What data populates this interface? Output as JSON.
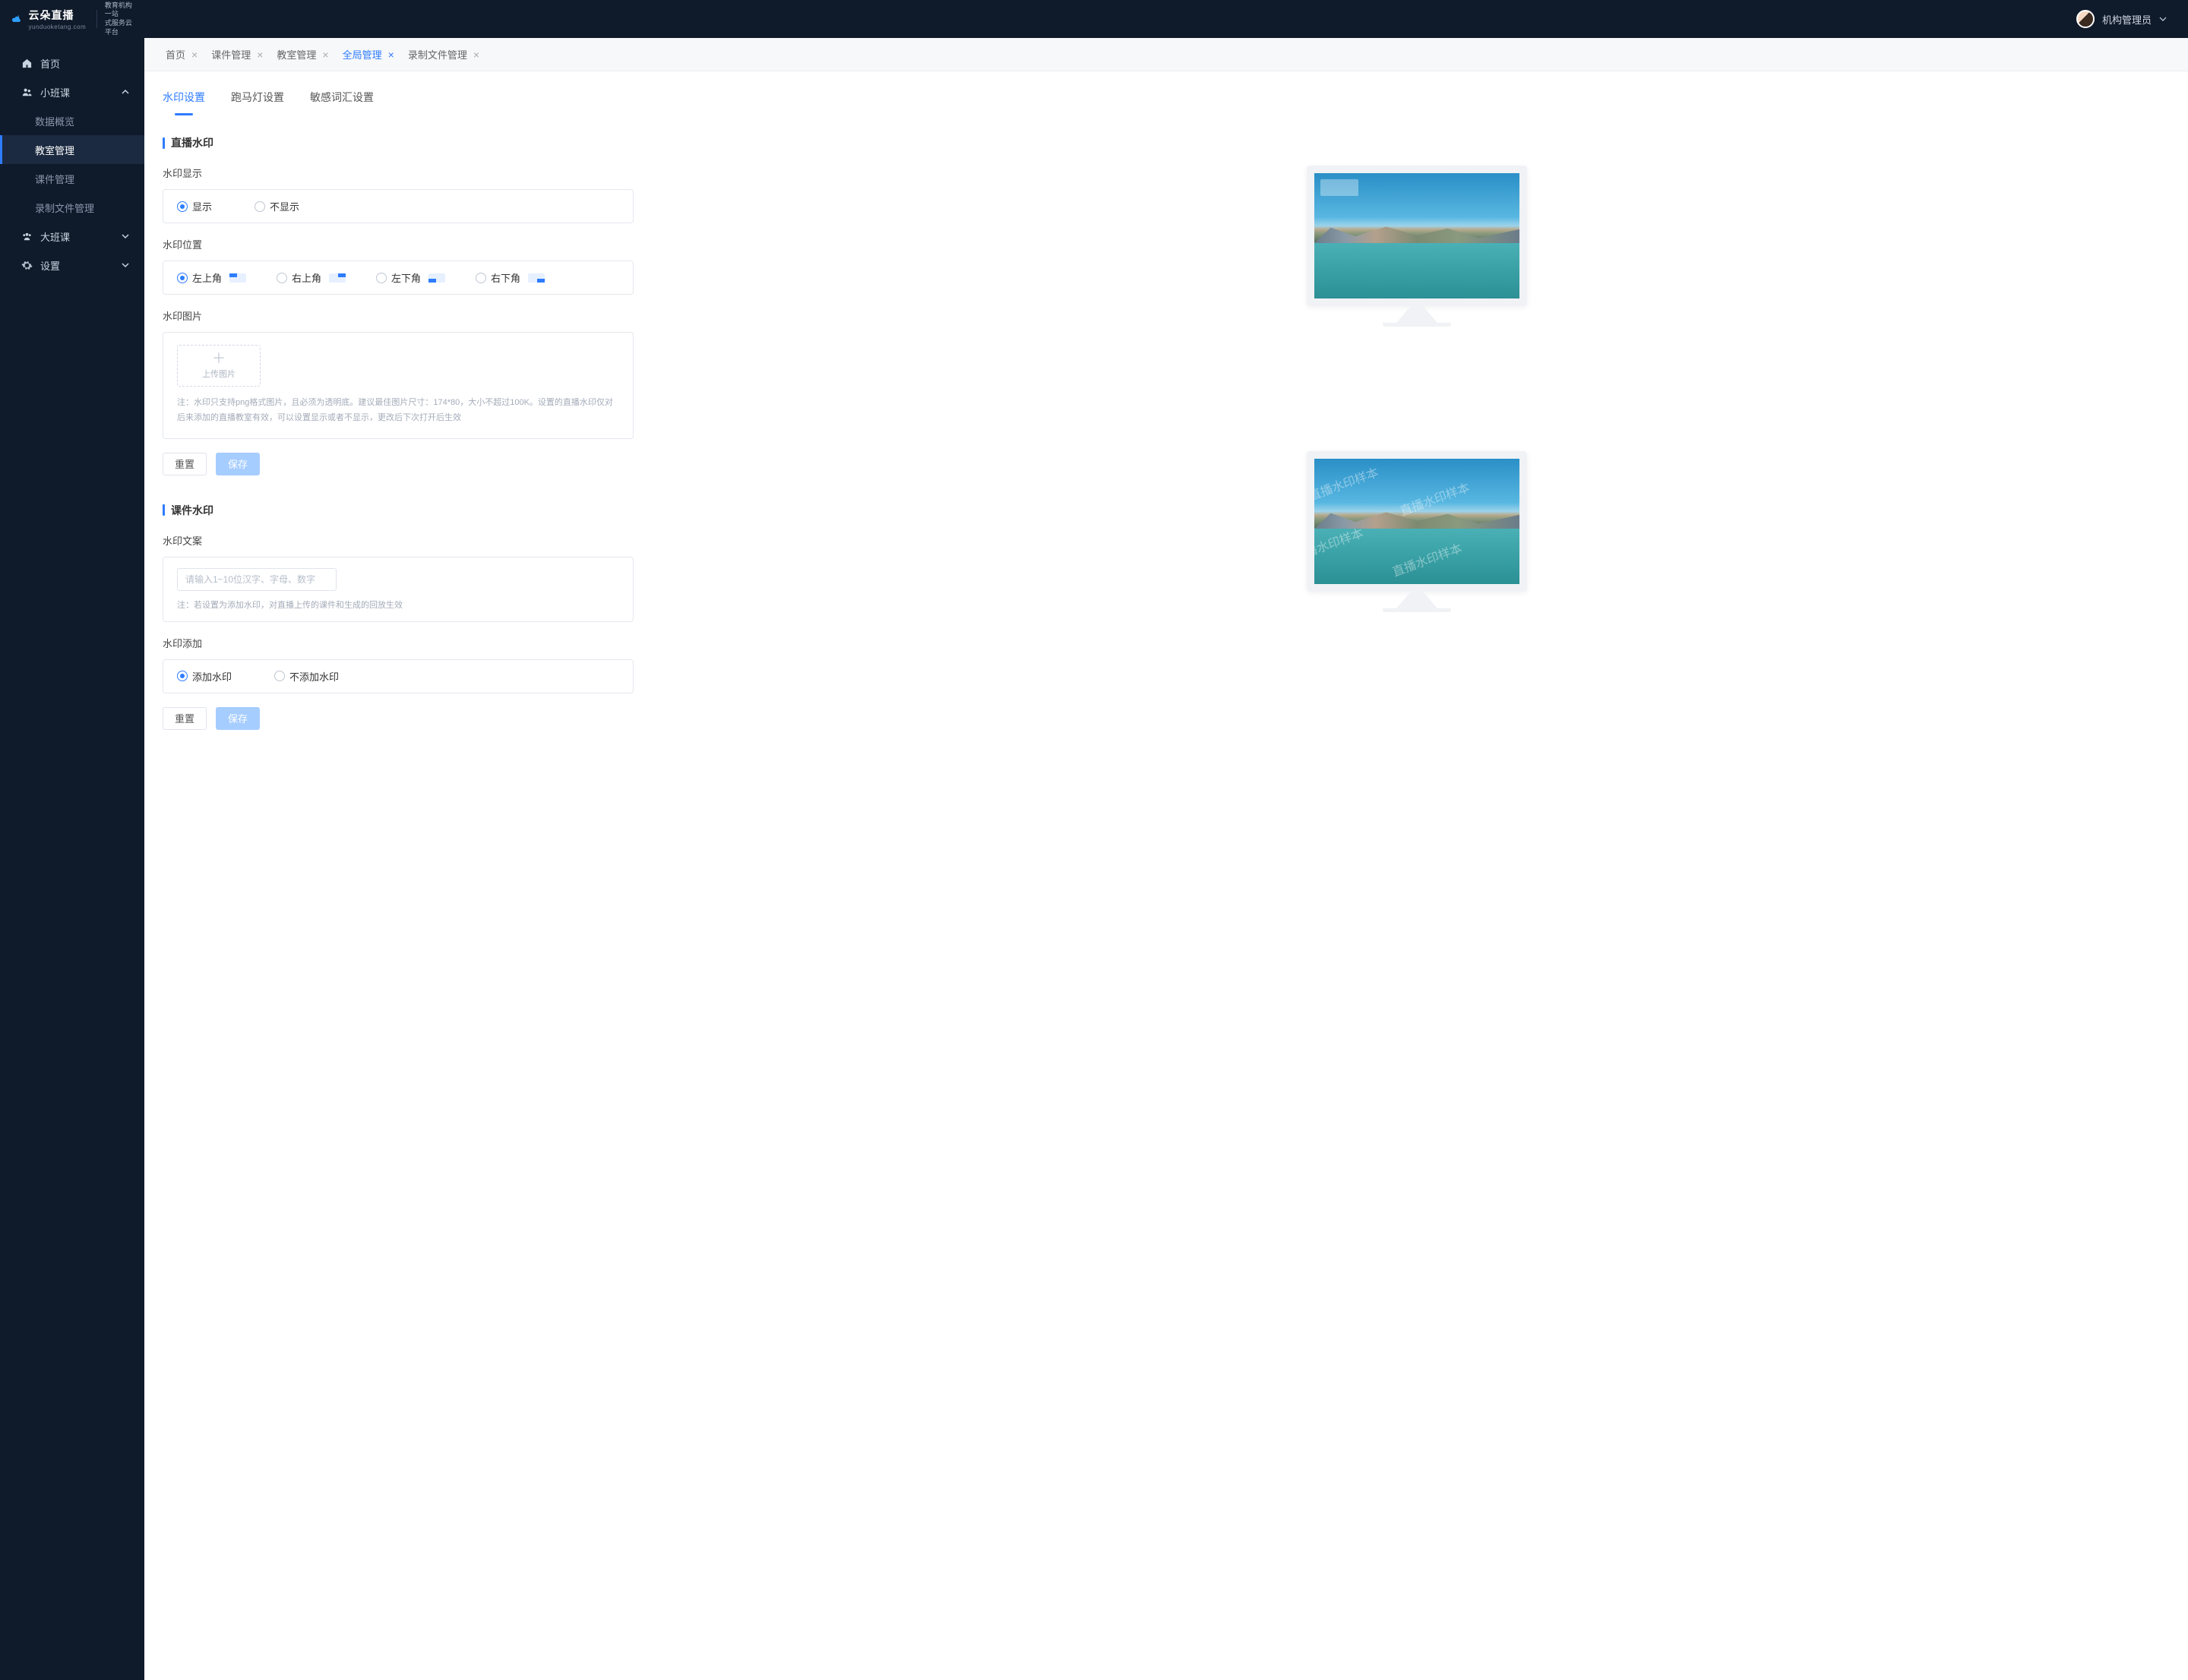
{
  "brand": {
    "title": "云朵直播",
    "subtitle": "yunduoketang.com",
    "tagline1": "教育机构一站",
    "tagline2": "式服务云平台"
  },
  "user": {
    "name": "机构管理员"
  },
  "sidebar": {
    "home": "首页",
    "small_class": "小班课",
    "sub": {
      "data_overview": "数据概览",
      "classroom_mgmt": "教室管理",
      "courseware_mgmt": "课件管理",
      "recording_mgmt": "录制文件管理"
    },
    "big_class": "大班课",
    "settings": "设置"
  },
  "breadcrumbs": {
    "home": "首页",
    "courseware": "课件管理",
    "classroom": "教室管理",
    "global": "全局管理",
    "recording": "录制文件管理"
  },
  "main_tabs": {
    "watermark": "水印设置",
    "marquee": "跑马灯设置",
    "sensitive": "敏感词汇设置"
  },
  "section1": {
    "title": "直播水印",
    "display_label": "水印显示",
    "display_show": "显示",
    "display_hide": "不显示",
    "position_label": "水印位置",
    "pos_tl": "左上角",
    "pos_tr": "右上角",
    "pos_bl": "左下角",
    "pos_br": "右下角",
    "image_label": "水印图片",
    "upload_text": "上传图片",
    "upload_note": "注：水印只支持png格式图片，且必须为透明底。建议最佳图片尺寸：174*80，大小不超过100K。设置的直播水印仅对后来添加的直播教室有效，可以设置显示或者不显示，更改后下次打开后生效",
    "reset": "重置",
    "save": "保存"
  },
  "section2": {
    "title": "课件水印",
    "text_label": "水印文案",
    "text_placeholder": "请输入1~10位汉字、字母、数字",
    "text_note": "注：若设置为添加水印，对直播上传的课件和生成的回放生效",
    "add_label": "水印添加",
    "add_yes": "添加水印",
    "add_no": "不添加水印",
    "reset": "重置",
    "save": "保存",
    "preview_sample": "直播水印样本"
  }
}
